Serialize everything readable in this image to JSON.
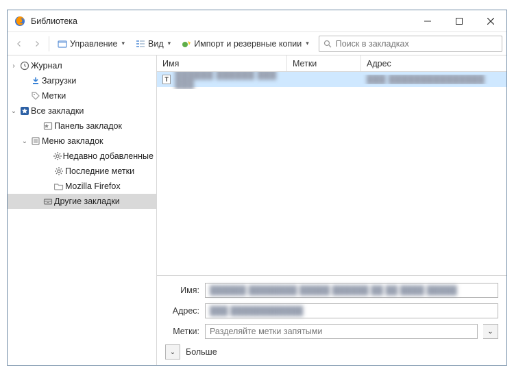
{
  "window": {
    "title": "Библиотека"
  },
  "toolbar": {
    "manage": "Управление",
    "view": "Вид",
    "import": "Импорт и резервные копии",
    "search_placeholder": "Поиск в закладках"
  },
  "sidebar": {
    "journal": "Журнал",
    "downloads": "Загрузки",
    "tags": "Метки",
    "all_bookmarks": "Все закладки",
    "toolbar_bookmarks": "Панель закладок",
    "bookmarks_menu": "Меню закладок",
    "recent": "Недавно добавленные",
    "recent_tags": "Последние метки",
    "firefox": "Mozilla Firefox",
    "other": "Другие закладки"
  },
  "columns": {
    "name": "Имя",
    "tags": "Метки",
    "address": "Адрес"
  },
  "list": {
    "row0": {
      "icon": "T",
      "name_blur": "██████ ██████ ███ ███",
      "addr_blur": "███ ███████████████"
    }
  },
  "details": {
    "name_label": "Имя:",
    "addr_label": "Адрес:",
    "tags_label": "Метки:",
    "name_blur": "██████ ████████ █████ ██████ ██ ██ ████   █████",
    "addr_blur": "███ ████████████",
    "tags_placeholder": "Разделяйте метки запятыми",
    "more": "Больше"
  }
}
